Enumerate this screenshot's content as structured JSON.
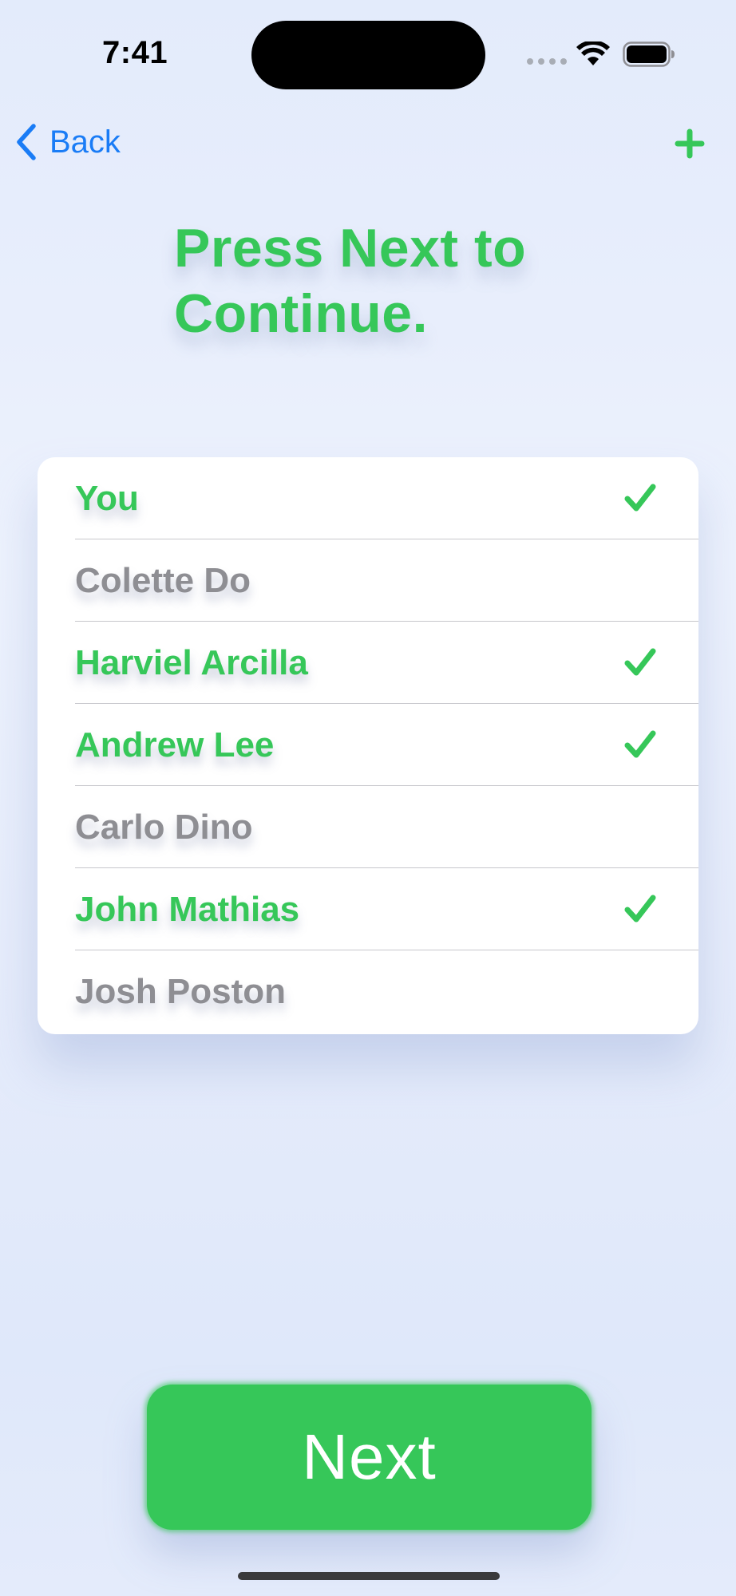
{
  "status_bar": {
    "time": "7:41"
  },
  "nav": {
    "back_label": "Back",
    "add_icon": "plus-icon",
    "back_icon": "chevron-left-icon"
  },
  "title": "Press Next to Continue.",
  "people": [
    {
      "name": "You",
      "selected": true
    },
    {
      "name": "Colette Do",
      "selected": false
    },
    {
      "name": "Harviel Arcilla",
      "selected": true
    },
    {
      "name": "Andrew Lee",
      "selected": true
    },
    {
      "name": "Carlo Dino",
      "selected": false
    },
    {
      "name": "John Mathias",
      "selected": true
    },
    {
      "name": "Josh Poston",
      "selected": false
    }
  ],
  "next_button": {
    "label": "Next"
  },
  "colors": {
    "accent_green": "#36c759",
    "link_blue": "#1a7cf6",
    "unselected_gray": "#8e8e93"
  }
}
